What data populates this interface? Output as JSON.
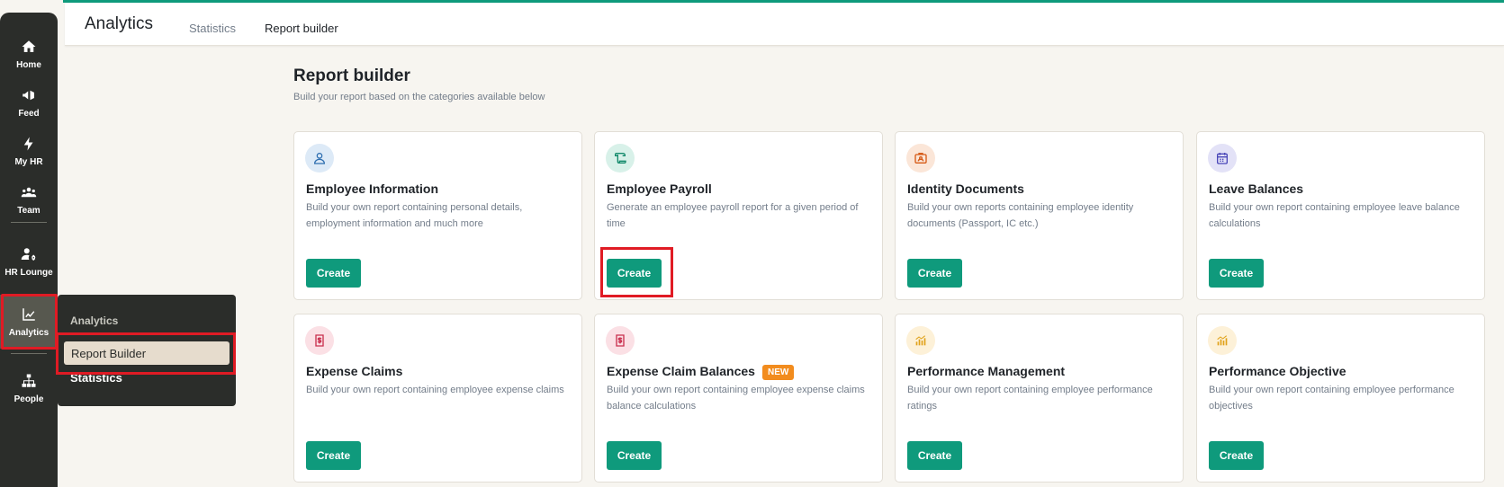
{
  "sidebar": {
    "items": [
      {
        "label": "Home",
        "icon": "home-icon"
      },
      {
        "label": "Feed",
        "icon": "megaphone-icon"
      },
      {
        "label": "My HR",
        "icon": "bolt-icon"
      },
      {
        "label": "Team",
        "icon": "team-icon"
      },
      {
        "label": "HR Lounge",
        "icon": "user-gear-icon"
      },
      {
        "label": "Analytics",
        "icon": "chart-icon",
        "active": true
      },
      {
        "label": "People",
        "icon": "org-chart-icon"
      }
    ]
  },
  "flyout": {
    "title": "Analytics",
    "items": [
      "Report Builder",
      "Statistics"
    ]
  },
  "topbar": {
    "title": "Analytics",
    "tabs": [
      "Statistics",
      "Report builder"
    ]
  },
  "page": {
    "title": "Report builder",
    "subtitle": "Build your report based on the categories available below"
  },
  "cards": [
    {
      "title": "Employee Information",
      "desc": "Build your own report containing personal details, employment information and much more",
      "button": "Create",
      "icon": "user-icon",
      "icon_color": "#2f6fb0",
      "icon_bg": "#ddeaf7"
    },
    {
      "title": "Employee Payroll",
      "desc": "Generate an employee payroll report for a given period of time",
      "button": "Create",
      "icon": "scroll-icon",
      "icon_color": "#138a6b",
      "icon_bg": "#d8f1e9"
    },
    {
      "title": "Identity Documents",
      "desc": "Build your own reports containing employee identity documents (Passport, IC etc.)",
      "button": "Create",
      "icon": "id-card-icon",
      "icon_color": "#d65a16",
      "icon_bg": "#fbe6d8"
    },
    {
      "title": "Leave Balances",
      "desc": "Build your own report containing employee leave balance calculations",
      "button": "Create",
      "icon": "calendar-icon",
      "icon_color": "#4a47b8",
      "icon_bg": "#e3e2f7"
    },
    {
      "title": "Expense Claims",
      "desc": "Build your own report containing employee expense claims",
      "button": "Create",
      "icon": "receipt-icon",
      "icon_color": "#c9304f",
      "icon_bg": "#fbe0e5"
    },
    {
      "title": "Expense Claim Balances",
      "badge": "NEW",
      "desc": "Build your own report containing employee expense claims balance calculations",
      "button": "Create",
      "icon": "receipt-icon",
      "icon_color": "#c9304f",
      "icon_bg": "#fbe0e5"
    },
    {
      "title": "Performance Management",
      "desc": "Build your own report containing employee performance ratings",
      "button": "Create",
      "icon": "bar-chart-icon",
      "icon_color": "#e0a21a",
      "icon_bg": "#fdf1d8"
    },
    {
      "title": "Performance Objective",
      "desc": "Build your own report containing employee performance objectives",
      "button": "Create",
      "icon": "bar-chart-icon",
      "icon_color": "#e0a21a",
      "icon_bg": "#fdf1d8"
    }
  ]
}
